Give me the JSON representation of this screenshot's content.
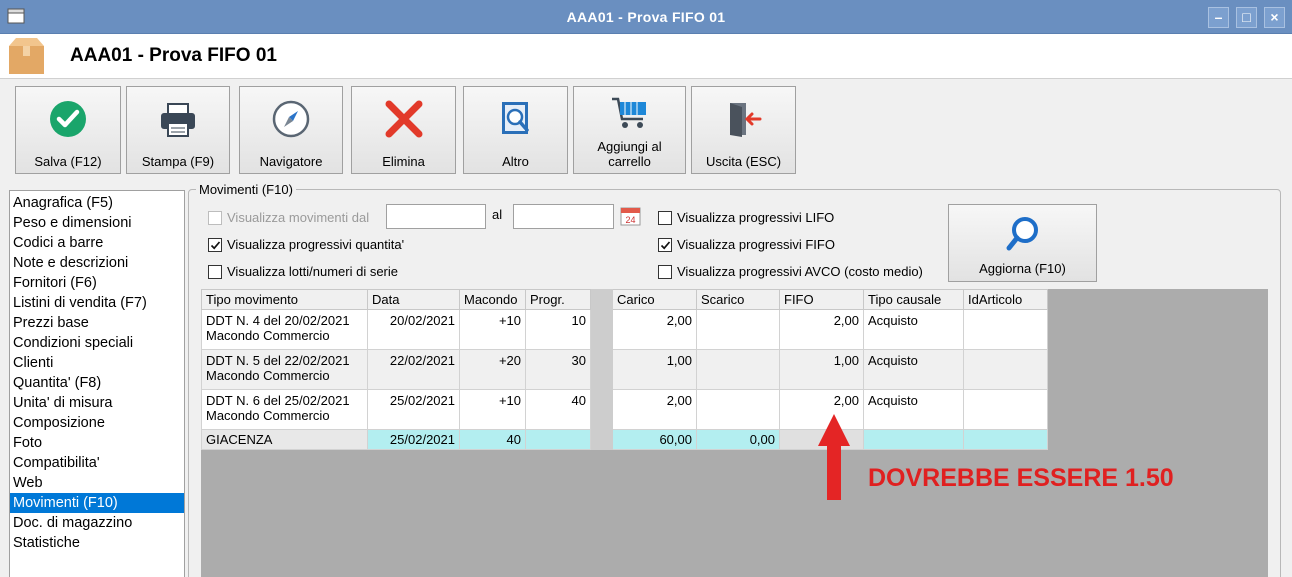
{
  "window": {
    "title": "AAA01 - Prova FIFO 01",
    "controls": [
      "minimize",
      "maximize",
      "close"
    ]
  },
  "header": {
    "title": "AAA01 - Prova FIFO 01",
    "icon": "package-box-icon"
  },
  "toolbar": {
    "save": {
      "label": "Salva (F12)",
      "icon": "checkmark-circle-icon"
    },
    "print": {
      "label": "Stampa (F9)",
      "icon": "printer-icon"
    },
    "navigator": {
      "label": "Navigatore",
      "icon": "compass-icon"
    },
    "delete": {
      "label": "Elimina",
      "icon": "red-x-icon"
    },
    "other": {
      "label": "Altro",
      "icon": "book-search-icon"
    },
    "cart": {
      "label": "Aggiungi al carrello",
      "icon": "shopping-cart-icon"
    },
    "exit": {
      "label": "Uscita (ESC)",
      "icon": "exit-door-icon"
    }
  },
  "nav": {
    "items": [
      "Anagrafica (F5)",
      "Peso e dimensioni",
      "Codici a barre",
      "Note e descrizioni",
      "Fornitori (F6)",
      "Listini di vendita (F7)",
      "Prezzi base",
      "Condizioni speciali",
      "Clienti",
      "Quantita' (F8)",
      "Unita' di misura",
      "Composizione",
      "Foto",
      "Compatibilita'",
      "Web",
      "Movimenti (F10)",
      "Doc. di magazzino",
      "Statistiche"
    ],
    "selected": "Movimenti (F10)"
  },
  "movimenti": {
    "group_title": "Movimenti (F10)",
    "filters": {
      "show_from": {
        "label": "Visualizza movimenti dal",
        "checked": false,
        "disabled": true
      },
      "from_value": "",
      "to_label": "al",
      "to_value": "",
      "prog_qty": {
        "label": "Visualizza progressivi quantita'",
        "checked": true
      },
      "lots": {
        "label": "Visualizza lotti/numeri di serie",
        "checked": false
      },
      "lifo": {
        "label": "Visualizza progressivi LIFO",
        "checked": false
      },
      "fifo": {
        "label": "Visualizza progressivi FIFO",
        "checked": true
      },
      "avco": {
        "label": "Visualizza progressivi AVCO (costo medio)",
        "checked": false
      }
    },
    "refresh": {
      "label": "Aggiorna (F10)",
      "icon": "magnifier-icon"
    },
    "columns": [
      "Tipo movimento",
      "Data",
      "Macondo",
      "Progr.",
      "",
      "Carico",
      "Scarico",
      "FIFO",
      "Tipo causale",
      "IdArticolo"
    ],
    "rows": [
      {
        "tipo": [
          "DDT N. 4 del 20/02/2021",
          "Macondo Commercio"
        ],
        "data": "20/02/2021",
        "macondo": "+10",
        "progr": "10",
        "carico": "2,00",
        "scarico": "",
        "fifo": "2,00",
        "causale": "Acquisto",
        "id": ""
      },
      {
        "tipo": [
          "DDT N. 5 del 22/02/2021",
          "Macondo Commercio"
        ],
        "data": "22/02/2021",
        "macondo": "+20",
        "progr": "30",
        "carico": "1,00",
        "scarico": "",
        "fifo": "1,00",
        "causale": "Acquisto",
        "id": ""
      },
      {
        "tipo": [
          "DDT N. 6 del 25/02/2021",
          "Macondo Commercio"
        ],
        "data": "25/02/2021",
        "macondo": "+10",
        "progr": "40",
        "carico": "2,00",
        "scarico": "",
        "fifo": "2,00",
        "causale": "Acquisto",
        "id": ""
      }
    ],
    "total": {
      "tipo": "GIACENZA",
      "data": "25/02/2021",
      "macondo": "40",
      "progr": "",
      "carico": "60,00",
      "scarico": "0,00",
      "fifo": "",
      "causale": "",
      "id": ""
    }
  },
  "annotation": {
    "text": "DOVREBBE ESSERE 1.50",
    "color": "#e02020"
  }
}
